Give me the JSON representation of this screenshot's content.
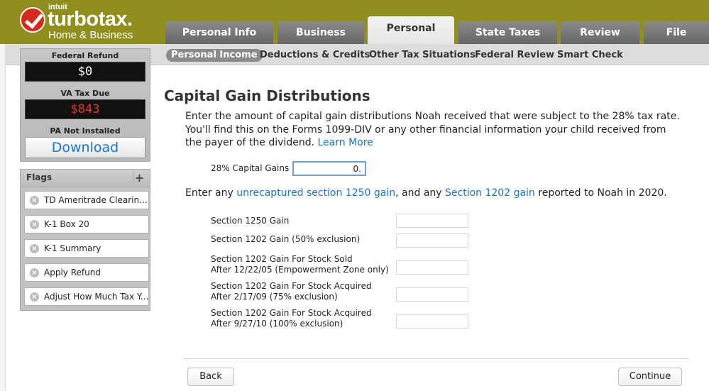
{
  "brand": {
    "company": "intuit",
    "product": "turbotax.",
    "edition": "Home & Business"
  },
  "tabs": [
    {
      "label": "Personal Info",
      "active": false
    },
    {
      "label": "Business",
      "active": false
    },
    {
      "label": "Personal",
      "active": true
    },
    {
      "label": "State Taxes",
      "active": false
    },
    {
      "label": "Review",
      "active": false
    },
    {
      "label": "File",
      "active": false
    }
  ],
  "subnav": [
    {
      "label": "Personal Income",
      "active": true
    },
    {
      "label": "Deductions & Credits",
      "active": false
    },
    {
      "label": "Other Tax Situations",
      "active": false
    },
    {
      "label": "Federal Review",
      "active": false
    },
    {
      "label": "Smart Check",
      "active": false
    }
  ],
  "sidebar": {
    "federal_refund_label": "Federal Refund",
    "federal_refund_value": "$0",
    "state_due_label": "VA Tax Due",
    "state_due_value": "$843",
    "state_not_installed_label": "PA Not Installed",
    "download_label": "Download"
  },
  "flags": {
    "title": "Flags",
    "add_symbol": "+",
    "items": [
      {
        "label": "TD Ameritrade Clearin..."
      },
      {
        "label": "K-1 Box 20"
      },
      {
        "label": "K-1 Summary"
      },
      {
        "label": "Apply Refund"
      },
      {
        "label": "Adjust How Much Tax Y..."
      }
    ]
  },
  "main": {
    "title": "Capital Gain Distributions",
    "intro_text": "Enter the amount of capital gain distributions Noah received that were subject to the 28% tax rate. You'll find this on the Forms 1099-DIV or any other financial information your child received from the payer of the dividend.",
    "learn_more": "Learn More",
    "capital_gains_label": "28% Capital Gains",
    "capital_gains_value": "0.",
    "line2_prefix": "Enter any",
    "line2_link1": "unrecaptured section 1250 gain",
    "line2_middle": ", and any",
    "line2_link2": "Section 1202 gain",
    "line2_suffix": "reported to Noah in 2020.",
    "fields": [
      {
        "line1": "Section 1250 Gain",
        "line2": "",
        "value": ""
      },
      {
        "line1": "Section 1202 Gain (50% exclusion)",
        "line2": "",
        "value": ""
      },
      {
        "line1": "Section 1202 Gain For Stock Sold",
        "line2": "After 12/22/05 (Empowerment Zone only)",
        "value": ""
      },
      {
        "line1": "Section 1202 Gain For Stock Acquired",
        "line2": "After 2/17/09 (75% exclusion)",
        "value": ""
      },
      {
        "line1": "Section 1202 Gain For Stock Acquired",
        "line2": "After 9/27/10 (100% exclusion)",
        "value": ""
      }
    ],
    "back_label": "Back",
    "continue_label": "Continue"
  },
  "colors": {
    "header": "#8f8e1f",
    "link": "#1a74c6",
    "tax_due": "#e03a2c",
    "logo_check": "#d52b1e"
  }
}
